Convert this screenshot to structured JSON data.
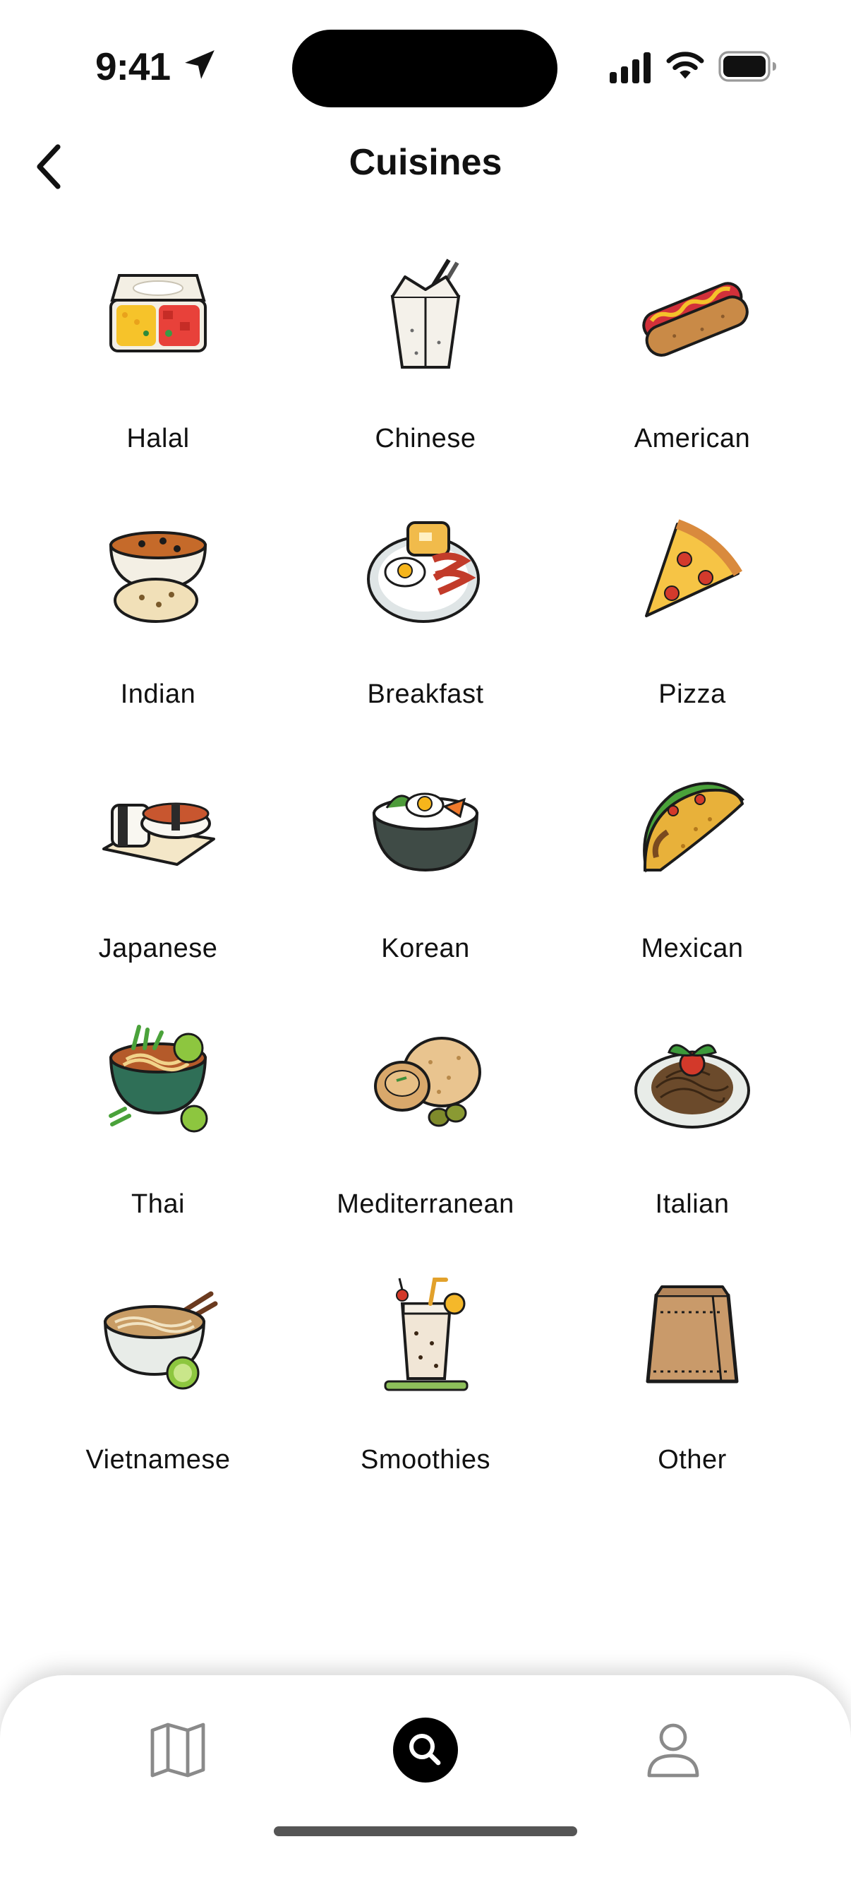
{
  "status_bar": {
    "time": "9:41"
  },
  "header": {
    "title": "Cuisines"
  },
  "cuisines": [
    {
      "label": "Halal",
      "icon": "halal-takeout-icon"
    },
    {
      "label": "Chinese",
      "icon": "chinese-takeout-box-icon"
    },
    {
      "label": "American",
      "icon": "hot-dog-icon"
    },
    {
      "label": "Indian",
      "icon": "curry-naan-icon"
    },
    {
      "label": "Breakfast",
      "icon": "breakfast-plate-icon"
    },
    {
      "label": "Pizza",
      "icon": "pizza-slice-icon"
    },
    {
      "label": "Japanese",
      "icon": "sushi-icon"
    },
    {
      "label": "Korean",
      "icon": "bibimbap-icon"
    },
    {
      "label": "Mexican",
      "icon": "taco-icon"
    },
    {
      "label": "Thai",
      "icon": "thai-noodle-bowl-icon"
    },
    {
      "label": "Mediterranean",
      "icon": "pita-falafel-icon"
    },
    {
      "label": "Italian",
      "icon": "spaghetti-icon"
    },
    {
      "label": "Vietnamese",
      "icon": "pho-bowl-icon"
    },
    {
      "label": "Smoothies",
      "icon": "smoothie-cup-icon"
    },
    {
      "label": "Other",
      "icon": "paper-bag-icon"
    }
  ],
  "tab_bar": {
    "tabs": [
      {
        "name": "map",
        "icon": "map-icon",
        "active": false
      },
      {
        "name": "search",
        "icon": "search-icon",
        "active": true
      },
      {
        "name": "profile",
        "icon": "person-icon",
        "active": false
      }
    ]
  }
}
